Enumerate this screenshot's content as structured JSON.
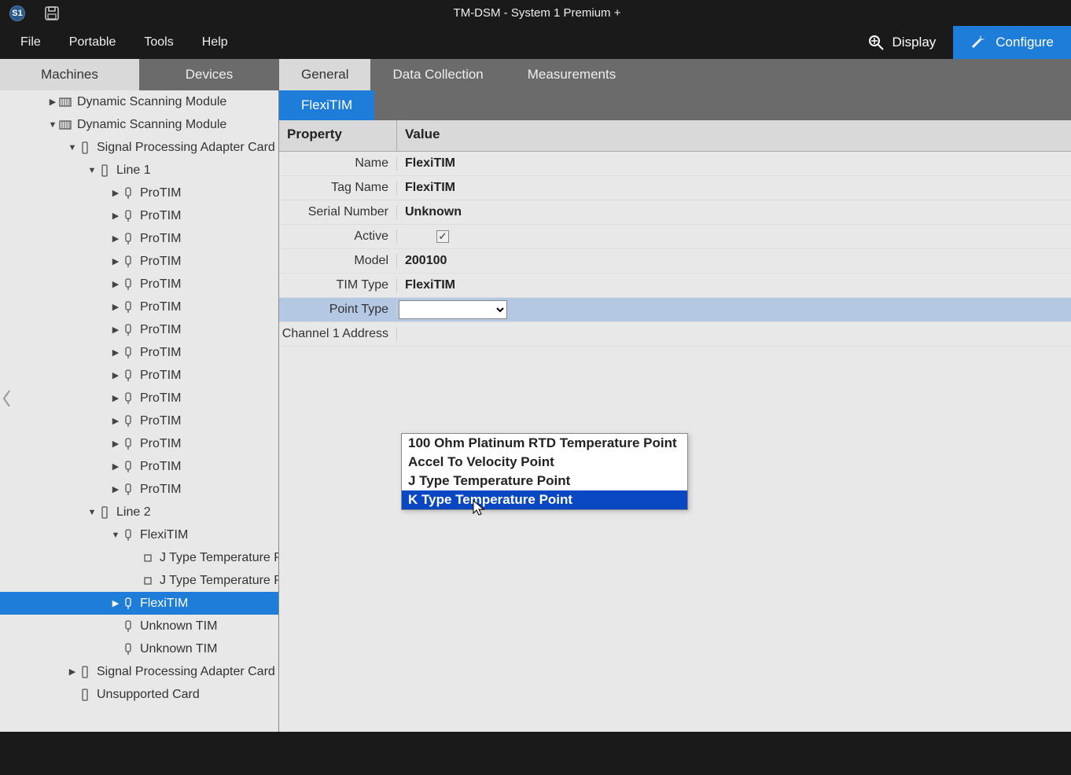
{
  "title": "TM-DSM - System 1 Premium +",
  "menu": {
    "items": [
      "File",
      "Portable",
      "Tools",
      "Help"
    ]
  },
  "modes": {
    "display": "Display",
    "configure": "Configure"
  },
  "left_tabs": [
    "Machines",
    "Devices"
  ],
  "sub_tabs": [
    "General",
    "Data Collection",
    "Measurements"
  ],
  "detail_tab": "FlexiTIM",
  "tree": {
    "nodes": [
      {
        "indent": 60,
        "expander": "▶",
        "icon": "module",
        "label": "Dynamic Scanning Module"
      },
      {
        "indent": 60,
        "expander": "▼",
        "icon": "module",
        "label": "Dynamic Scanning Module"
      },
      {
        "indent": 85,
        "expander": "▼",
        "icon": "card",
        "label": "Signal Processing Adapter Card"
      },
      {
        "indent": 110,
        "expander": "▼",
        "icon": "card",
        "label": "Line 1"
      },
      {
        "indent": 140,
        "expander": "▶",
        "icon": "tim",
        "label": "ProTIM"
      },
      {
        "indent": 140,
        "expander": "▶",
        "icon": "tim",
        "label": "ProTIM"
      },
      {
        "indent": 140,
        "expander": "▶",
        "icon": "tim",
        "label": "ProTIM"
      },
      {
        "indent": 140,
        "expander": "▶",
        "icon": "tim",
        "label": "ProTIM"
      },
      {
        "indent": 140,
        "expander": "▶",
        "icon": "tim",
        "label": "ProTIM"
      },
      {
        "indent": 140,
        "expander": "▶",
        "icon": "tim",
        "label": "ProTIM"
      },
      {
        "indent": 140,
        "expander": "▶",
        "icon": "tim",
        "label": "ProTIM"
      },
      {
        "indent": 140,
        "expander": "▶",
        "icon": "tim",
        "label": "ProTIM"
      },
      {
        "indent": 140,
        "expander": "▶",
        "icon": "tim",
        "label": "ProTIM"
      },
      {
        "indent": 140,
        "expander": "▶",
        "icon": "tim",
        "label": "ProTIM"
      },
      {
        "indent": 140,
        "expander": "▶",
        "icon": "tim",
        "label": "ProTIM"
      },
      {
        "indent": 140,
        "expander": "▶",
        "icon": "tim",
        "label": "ProTIM"
      },
      {
        "indent": 140,
        "expander": "▶",
        "icon": "tim",
        "label": "ProTIM"
      },
      {
        "indent": 140,
        "expander": "▶",
        "icon": "tim",
        "label": "ProTIM"
      },
      {
        "indent": 110,
        "expander": "▼",
        "icon": "card",
        "label": "Line 2"
      },
      {
        "indent": 140,
        "expander": "▼",
        "icon": "tim",
        "label": "FlexiTIM"
      },
      {
        "indent": 165,
        "expander": "",
        "icon": "point",
        "label": "J Type Temperature P"
      },
      {
        "indent": 165,
        "expander": "",
        "icon": "point",
        "label": "J Type Temperature P"
      },
      {
        "indent": 140,
        "expander": "▶",
        "icon": "tim",
        "label": "FlexiTIM",
        "selected": true
      },
      {
        "indent": 140,
        "expander": "",
        "icon": "tim",
        "label": "Unknown TIM"
      },
      {
        "indent": 140,
        "expander": "",
        "icon": "tim",
        "label": "Unknown TIM"
      },
      {
        "indent": 85,
        "expander": "▶",
        "icon": "card",
        "label": "Signal Processing Adapter Card"
      },
      {
        "indent": 85,
        "expander": "",
        "icon": "card",
        "label": "Unsupported Card"
      }
    ]
  },
  "props": {
    "header_prop": "Property",
    "header_val": "Value",
    "rows": [
      {
        "label": "Name",
        "value": "FlexiTIM"
      },
      {
        "label": "Tag Name",
        "value": "FlexiTIM"
      },
      {
        "label": "Serial Number",
        "value": "Unknown"
      },
      {
        "label": "Active",
        "value": "check"
      },
      {
        "label": "Model",
        "value": "200100"
      },
      {
        "label": "TIM Type",
        "value": "FlexiTIM"
      },
      {
        "label": "Point Type",
        "value": "select",
        "highlight": true
      },
      {
        "label": "Channel 1 Address",
        "value": ""
      }
    ]
  },
  "dropdown": {
    "options": [
      "100 Ohm Platinum RTD Temperature Point",
      "Accel To Velocity Point",
      "J Type Temperature Point",
      "K Type Temperature Point"
    ],
    "hover_index": 3
  }
}
